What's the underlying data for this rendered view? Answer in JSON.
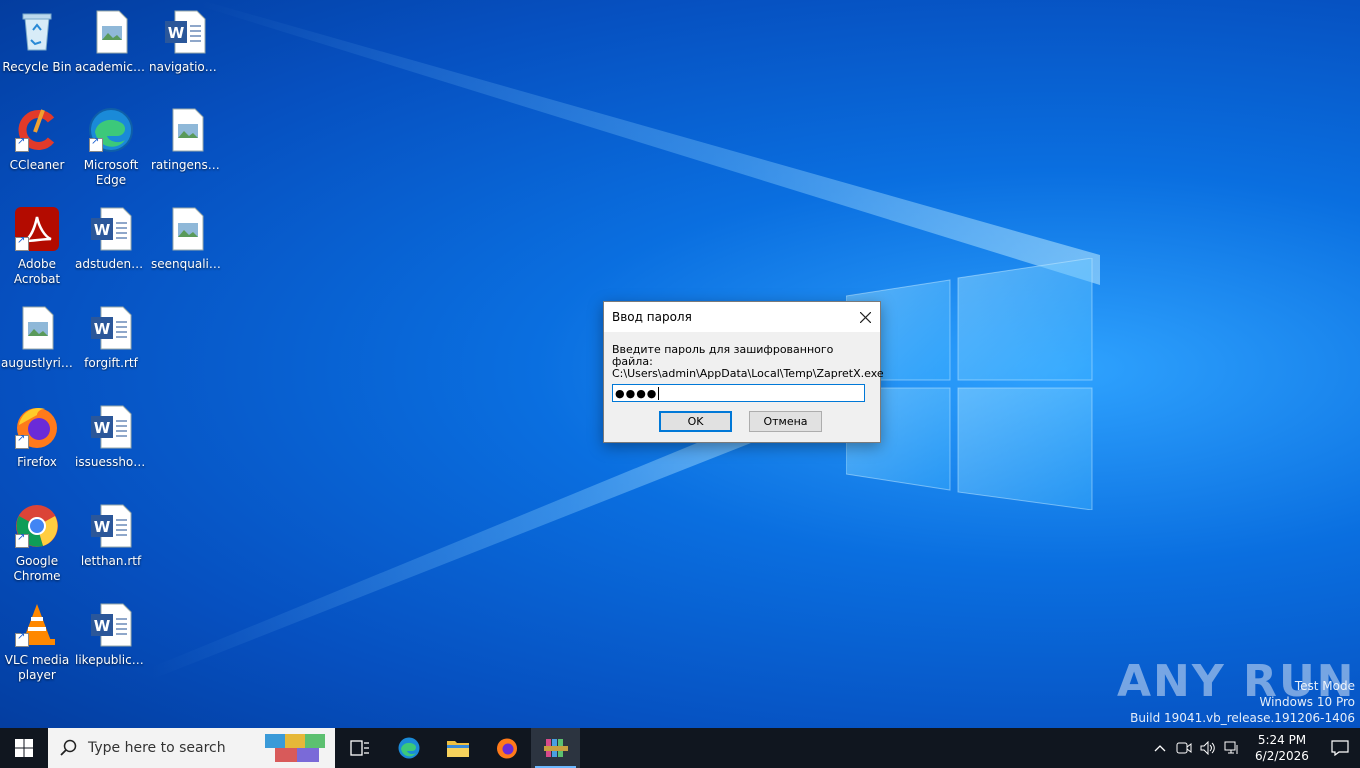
{
  "desktop": {
    "icons": [
      {
        "label": "Recycle Bin"
      },
      {
        "label": "academicp..."
      },
      {
        "label": "navigation..."
      },
      {
        "label": "CCleaner"
      },
      {
        "label": "Microsoft Edge"
      },
      {
        "label": "ratingensur..."
      },
      {
        "label": "Adobe Acrobat"
      },
      {
        "label": "adstudents..."
      },
      {
        "label": "seenqualit..."
      },
      {
        "label": "augustlyric..."
      },
      {
        "label": "forgift.rtf"
      },
      {
        "label": "Firefox"
      },
      {
        "label": "issuesshow..."
      },
      {
        "label": "Google Chrome"
      },
      {
        "label": "letthan.rtf"
      },
      {
        "label": "VLC media player"
      },
      {
        "label": "likepublicat..."
      }
    ]
  },
  "dialog": {
    "title": "Ввод пароля",
    "prompt": "Введите пароль для зашифрованного файла:",
    "path": "C:\\Users\\admin\\AppData\\Local\\Temp\\ZapretX.exe",
    "password_masked": "●●●●",
    "ok_label": "OK",
    "cancel_label": "Отмена"
  },
  "watermark": {
    "brand": "ANY RUN",
    "line1": "Test Mode",
    "line2": "Windows 10 Pro",
    "line3": "Build 19041.vb_release.191206-1406"
  },
  "taskbar": {
    "search_placeholder": "Type here to search",
    "time": "5:24 PM",
    "date": "6/2/2026"
  },
  "colors": {
    "accent": "#0078d7",
    "taskbar": "#10161f"
  }
}
